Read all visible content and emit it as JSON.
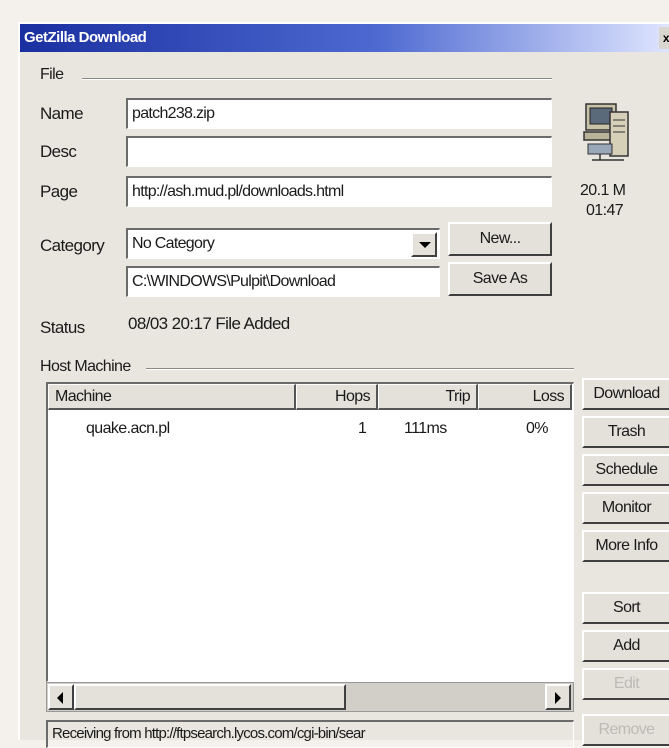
{
  "window": {
    "title": "GetZilla Download",
    "close_glyph": "x"
  },
  "file_group": {
    "label": "File"
  },
  "fields": {
    "name_label": "Name",
    "name_value": "patch238.zip",
    "desc_label": "Desc",
    "desc_value": "",
    "page_label": "Page",
    "page_value": "http://ash.mud.pl/downloads.html",
    "category_label": "Category",
    "category_value": "No Category",
    "path_value": "C:\\WINDOWS\\Pulpit\\Download",
    "status_label": "Status",
    "status_value": "08/03 20:17 File Added"
  },
  "buttons": {
    "new": "New...",
    "save_as": "Save As"
  },
  "file_info": {
    "icon": "computer-icon",
    "size": "20.1 M",
    "time": "01:47"
  },
  "host_group": {
    "label": "Host Machine"
  },
  "host_table": {
    "columns": [
      "Machine",
      "Hops",
      "Trip",
      "Loss"
    ],
    "rows": [
      {
        "machine": "quake.acn.pl",
        "hops": "1",
        "trip": "111ms",
        "loss": "0%"
      }
    ]
  },
  "side_buttons": [
    "Download",
    "Trash",
    "Schedule",
    "Monitor",
    "More Info",
    "Sort",
    "Add",
    "Edit",
    "Remove"
  ],
  "status_bar": {
    "text": "Receiving from http://ftpsearch.lycos.com/cgi-bin/sear"
  },
  "colors": {
    "title_start": "#1a2fa0",
    "title_end": "#e0e6ff",
    "face": "#e4e1db"
  }
}
